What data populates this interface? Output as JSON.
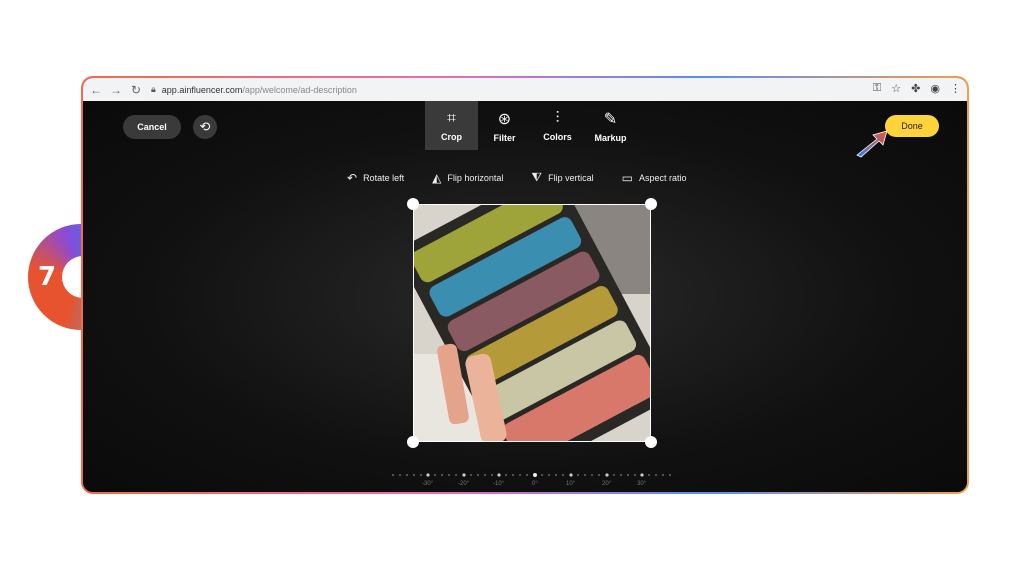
{
  "step": {
    "number": "7"
  },
  "browser": {
    "url_host": "app.ainfluencer.com",
    "url_path": "/app/welcome/ad-description",
    "icons": [
      "back-icon",
      "forward-icon",
      "reload-icon",
      "lock-icon",
      "key-icon",
      "star-icon",
      "extensions-icon",
      "account-icon",
      "menu-icon"
    ]
  },
  "editor": {
    "cancel_label": "Cancel",
    "done_label": "Done",
    "tabs": [
      {
        "label": "Crop",
        "icon": "crop-icon",
        "active": true
      },
      {
        "label": "Filter",
        "icon": "filter-icon",
        "active": false
      },
      {
        "label": "Colors",
        "icon": "sliders-icon",
        "active": false
      },
      {
        "label": "Markup",
        "icon": "pen-icon",
        "active": false
      }
    ],
    "tools": [
      {
        "label": "Rotate left",
        "icon": "rotate-left-icon"
      },
      {
        "label": "Flip horizontal",
        "icon": "flip-horizontal-icon"
      },
      {
        "label": "Flip vertical",
        "icon": "flip-vertical-icon"
      },
      {
        "label": "Aspect ratio",
        "icon": "aspect-ratio-icon"
      }
    ],
    "ruler_labels": [
      "-30°",
      "-20°",
      "-10°",
      "0°",
      "10°",
      "20°",
      "30°"
    ]
  },
  "colors": {
    "accent": "#ffd43b",
    "palette": [
      "#9ea43a",
      "#3a8eb0",
      "#8a5a62",
      "#b59a3a",
      "#c9c6a6",
      "#d7786a"
    ]
  }
}
